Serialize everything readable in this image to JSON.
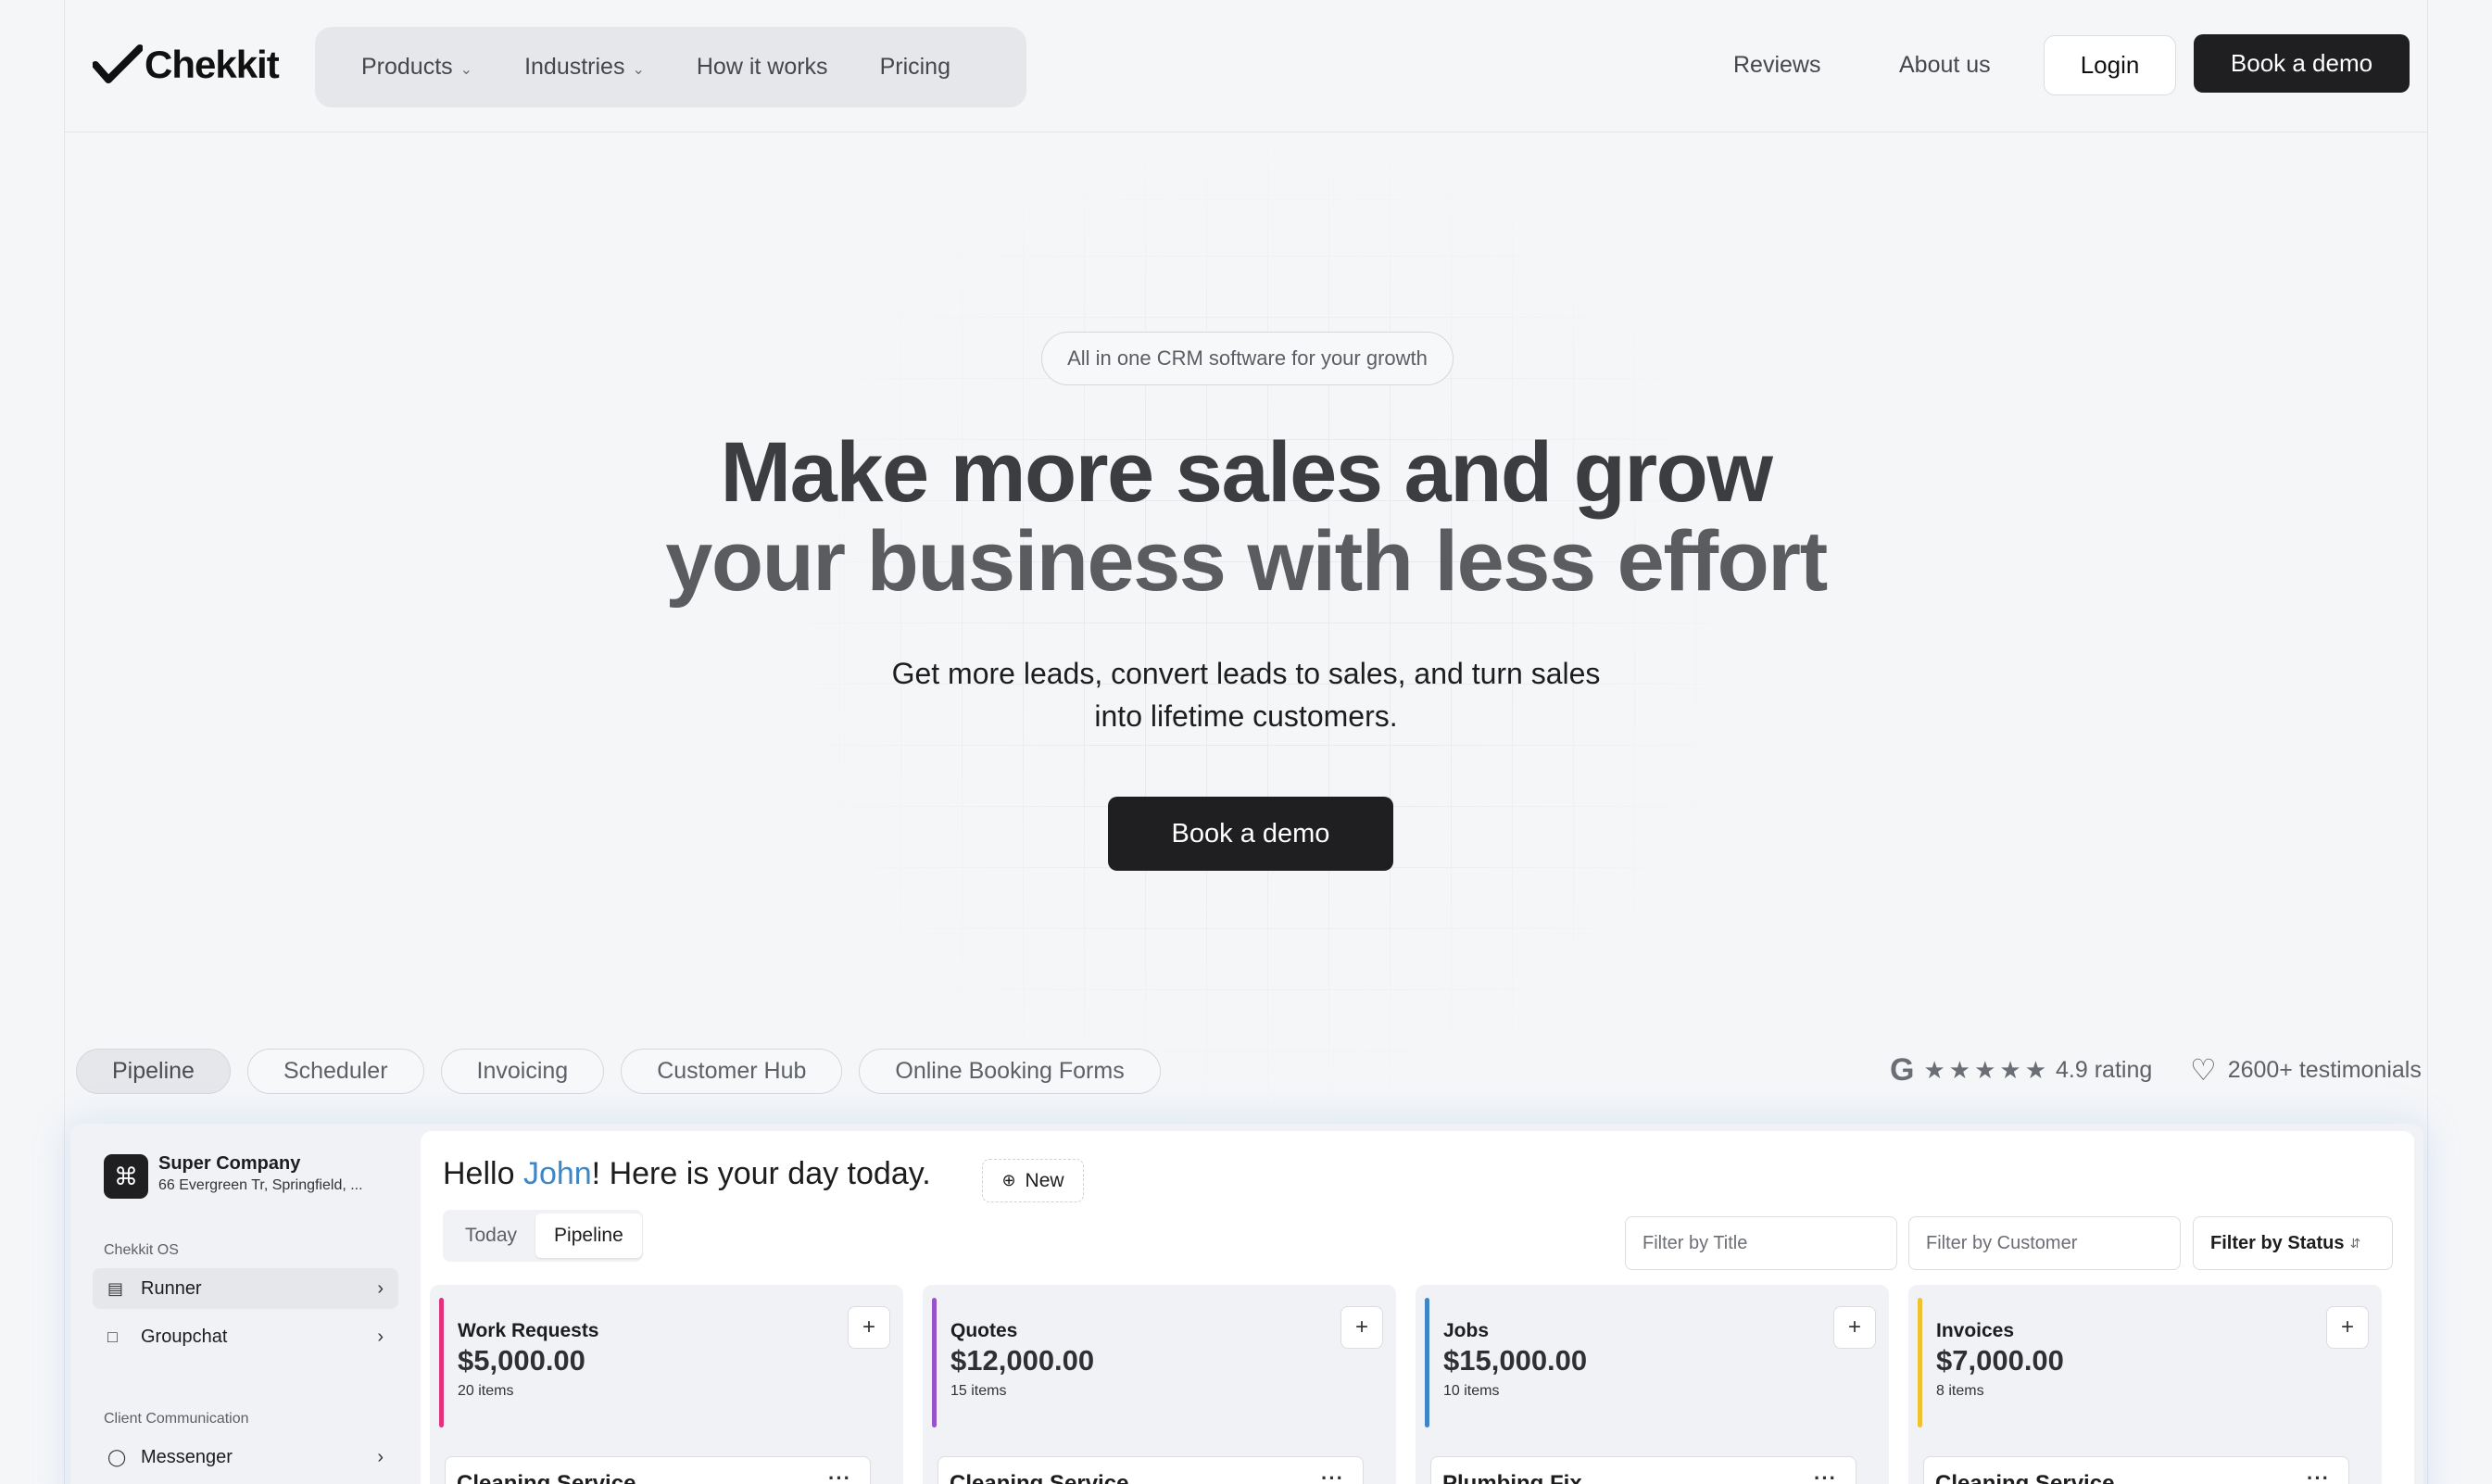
{
  "header": {
    "logo_text": "Chekkit",
    "nav": [
      {
        "label": "Products",
        "has_dropdown": true
      },
      {
        "label": "Industries",
        "has_dropdown": true
      },
      {
        "label": "How it works",
        "has_dropdown": false
      },
      {
        "label": "Pricing",
        "has_dropdown": false
      }
    ],
    "reviews_label": "Reviews",
    "about_label": "About us",
    "login_label": "Login",
    "demo_label": "Book a demo"
  },
  "hero": {
    "badge": "All in one CRM software for your growth",
    "headline_line1": "Make more sales and grow",
    "headline_line2": "your business with less effort",
    "subline": "Get more leads, convert leads to sales, and turn sales into lifetime customers.",
    "cta_label": "Book a demo"
  },
  "product_tabs": [
    {
      "label": "Pipeline",
      "active": true
    },
    {
      "label": "Scheduler",
      "active": false
    },
    {
      "label": "Invoicing",
      "active": false
    },
    {
      "label": "Customer Hub",
      "active": false
    },
    {
      "label": "Online Booking Forms",
      "active": false
    }
  ],
  "social_proof": {
    "google_letter": "G",
    "stars": 5,
    "rating_text": "4.9 rating",
    "testimonials_text": "2600+ testimonials"
  },
  "app": {
    "company_icon": "⌘",
    "company_name": "Super Company",
    "company_address": "66 Evergreen Tr, Springfield, ...",
    "section_os": "Chekkit OS",
    "items_os": [
      {
        "label": "Runner",
        "icon": "runner-icon",
        "active": true
      },
      {
        "label": "Groupchat",
        "icon": "chat-icon",
        "active": false
      }
    ],
    "section_comm": "Client Communication",
    "items_comm": [
      {
        "label": "Messenger",
        "icon": "messenger-icon",
        "active": false
      }
    ],
    "greeting_prefix": "Hello ",
    "greeting_name": "John",
    "greeting_suffix": "! Here is your day today.",
    "new_label": "New",
    "segments": [
      {
        "label": "Today",
        "active": false
      },
      {
        "label": "Pipeline",
        "active": true
      }
    ],
    "filter_title_placeholder": "Filter by Title",
    "filter_customer_placeholder": "Filter by Customer",
    "filter_status_label": "Filter by Status",
    "columns": [
      {
        "title": "Work Requests",
        "amount": "$5,000.00",
        "count": "20 items",
        "color": "#e2337a",
        "card": "Cleaning Service"
      },
      {
        "title": "Quotes",
        "amount": "$12,000.00",
        "count": "15 items",
        "color": "#9a54c9",
        "card": "Cleaning Service"
      },
      {
        "title": "Jobs",
        "amount": "$15,000.00",
        "count": "10 items",
        "color": "#3f86c6",
        "card": "Plumbing Fix"
      },
      {
        "title": "Invoices",
        "amount": "$7,000.00",
        "count": "8 items",
        "color": "#f0c231",
        "card": "Cleaning Service"
      }
    ]
  }
}
